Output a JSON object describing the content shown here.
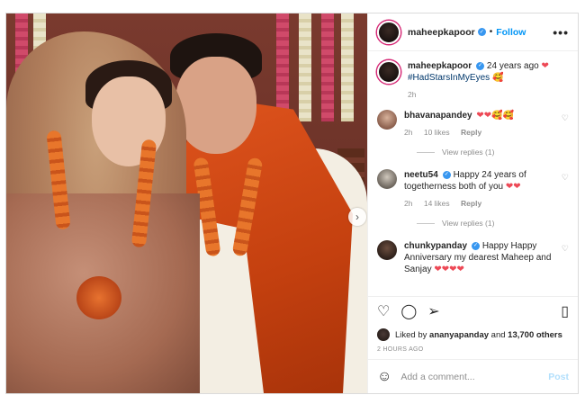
{
  "post": {
    "author": "maheepkapoor",
    "follow_label": "Follow",
    "separator": "•",
    "more_icon": "more-horizontal-icon"
  },
  "caption": {
    "username": "maheepkapoor",
    "text": "24 years ago",
    "heart": "❤",
    "hashtag": "#HadStarsInMyEyes",
    "emoji": "🥰",
    "age": "2h"
  },
  "comments": [
    {
      "username": "bhavanapandey",
      "text": "",
      "emojis": "❤❤🥰🥰",
      "age": "2h",
      "likes": "10 likes",
      "reply": "Reply",
      "view_replies": "View replies (1)"
    },
    {
      "username": "neetu54",
      "text": "Happy 24 years of togetherness both of you",
      "emojis": "❤❤",
      "age": "2h",
      "likes": "14 likes",
      "reply": "Reply",
      "view_replies": "View replies (1)"
    },
    {
      "username": "chunkypanday",
      "text": "Happy Happy Anniversary my dearest Maheep and Sanjay",
      "emojis": "❤❤❤❤",
      "age": "",
      "likes": "",
      "reply": "",
      "view_replies": ""
    }
  ],
  "likes": {
    "prefix": "Liked by",
    "user": "ananyapanday",
    "conj": "and",
    "count": "13,700 others"
  },
  "timestamp": "2 HOURS AGO",
  "add_comment": {
    "placeholder": "Add a comment...",
    "post_label": "Post"
  },
  "colors": {
    "accent": "#0095f6",
    "heart": "#ed4956",
    "verified": "#3897f0"
  }
}
